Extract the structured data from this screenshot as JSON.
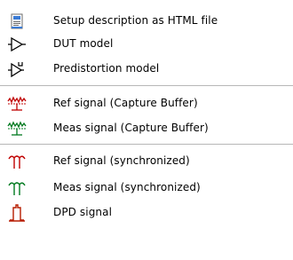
{
  "menu": {
    "items": [
      {
        "label": "Setup description as HTML file",
        "icon": "html-document-icon"
      },
      {
        "label": "DUT model",
        "icon": "amplifier-triangle-icon"
      },
      {
        "label": "Predistortion model",
        "icon": "predistortion-amplifier-icon"
      },
      {
        "label": "Ref signal (Capture Buffer)",
        "icon": "ref-capture-signal-icon"
      },
      {
        "label": "Meas signal (Capture Buffer)",
        "icon": "meas-capture-signal-icon"
      },
      {
        "label": "Ref signal (synchronized)",
        "icon": "ref-sync-signal-icon"
      },
      {
        "label": "Meas signal (synchronized)",
        "icon": "meas-sync-signal-icon"
      },
      {
        "label": "DPD signal",
        "icon": "dpd-signal-icon"
      }
    ]
  },
  "colors": {
    "ref": "#c00000",
    "meas": "#007a1f",
    "dpd": "#b71c00",
    "separator": "#b7b7b7"
  }
}
